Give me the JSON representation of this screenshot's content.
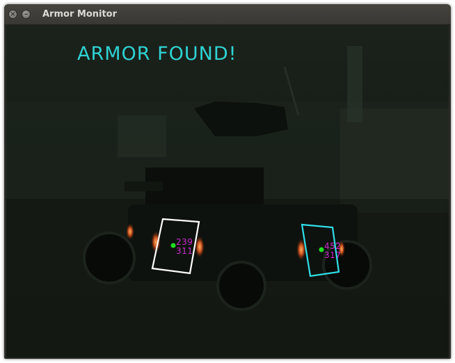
{
  "window": {
    "title": "Armor Monitor",
    "close_glyph": "×",
    "minimize_glyph": "–"
  },
  "overlay": {
    "status": "ARMOR FOUND!",
    "status_color": "#2fd3d3",
    "coord_color": "#d02bd0"
  },
  "detections": [
    {
      "x": "239",
      "y": "311",
      "box_color": "#ffffff",
      "center_color": "#22dd22"
    },
    {
      "x": "452",
      "y": "317",
      "box_color": "#2fe0e8",
      "center_color": "#22dd22"
    }
  ]
}
